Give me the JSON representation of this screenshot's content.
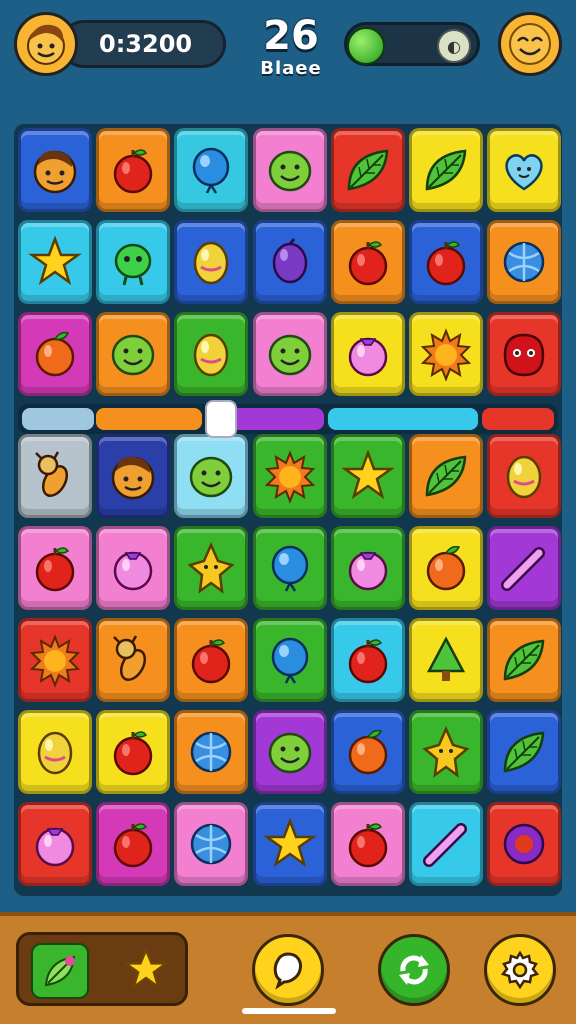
{
  "hud": {
    "score": "0:3200",
    "moves": "26",
    "moves_label": "Blaee",
    "colors": {
      "pill": "#233d50",
      "gem": "#3ec02c"
    }
  },
  "board": {
    "rows": [
      [
        {
          "c": "#2b62d8",
          "i": "face"
        },
        {
          "c": "#f5901f",
          "i": "apple"
        },
        {
          "c": "#35c8e0",
          "i": "balloon"
        },
        {
          "c": "#f27fd0",
          "i": "smile"
        },
        {
          "c": "#e6362a",
          "i": "leaf"
        },
        {
          "c": "#f6e01d",
          "i": "leaf"
        },
        {
          "c": "#f6e01d",
          "i": "heart"
        }
      ],
      [
        {
          "c": "#37c9ea",
          "i": "star"
        },
        {
          "c": "#37c9ea",
          "i": "alien"
        },
        {
          "c": "#2b62d8",
          "i": "egg"
        },
        {
          "c": "#2b62d8",
          "i": "plum"
        },
        {
          "c": "#f5901f",
          "i": "apple"
        },
        {
          "c": "#2b62d8",
          "i": "apple"
        },
        {
          "c": "#f5901f",
          "i": "ball"
        }
      ],
      [
        {
          "c": "#d43ab8",
          "i": "fruit"
        },
        {
          "c": "#f5901f",
          "i": "smile"
        },
        {
          "c": "#3ab62c",
          "i": "egg"
        },
        {
          "c": "#f27fd0",
          "i": "smile"
        },
        {
          "c": "#f6e01d",
          "i": "berry"
        },
        {
          "c": "#f6e01d",
          "i": "sun"
        },
        {
          "c": "#e6362a",
          "i": "blob"
        }
      ],
      [
        {
          "c": "#b7c3cc",
          "i": "bug"
        },
        {
          "c": "#2a3fa8",
          "i": "face"
        },
        {
          "c": "#90def3",
          "i": "smile"
        },
        {
          "c": "#3ab62c",
          "i": "sun"
        },
        {
          "c": "#3ab62c",
          "i": "star"
        },
        {
          "c": "#f5901f",
          "i": "leaf"
        },
        {
          "c": "#e6362a",
          "i": "egg"
        }
      ],
      [
        {
          "c": "#f27fd0",
          "i": "apple"
        },
        {
          "c": "#f27fd0",
          "i": "berry"
        },
        {
          "c": "#3ab62c",
          "i": "spark"
        },
        {
          "c": "#3ab62c",
          "i": "balloon"
        },
        {
          "c": "#3ab62c",
          "i": "berry"
        },
        {
          "c": "#f6e01d",
          "i": "fruit"
        },
        {
          "c": "#a238d6",
          "i": "wand"
        }
      ],
      [
        {
          "c": "#e6362a",
          "i": "sun"
        },
        {
          "c": "#f5901f",
          "i": "bug"
        },
        {
          "c": "#f5901f",
          "i": "apple"
        },
        {
          "c": "#3ab62c",
          "i": "balloon"
        },
        {
          "c": "#37c9ea",
          "i": "apple"
        },
        {
          "c": "#f6e01d",
          "i": "tree"
        },
        {
          "c": "#f5901f",
          "i": "leaf"
        }
      ],
      [
        {
          "c": "#f6e01d",
          "i": "egg"
        },
        {
          "c": "#f6e01d",
          "i": "apple"
        },
        {
          "c": "#f5901f",
          "i": "ball"
        },
        {
          "c": "#a238d6",
          "i": "smile"
        },
        {
          "c": "#2b62d8",
          "i": "fruit"
        },
        {
          "c": "#3ab62c",
          "i": "spark"
        },
        {
          "c": "#2b62d8",
          "i": "leaf"
        }
      ],
      [
        {
          "c": "#e6362a",
          "i": "berry"
        },
        {
          "c": "#d43ab8",
          "i": "apple"
        },
        {
          "c": "#f27fd0",
          "i": "ball"
        },
        {
          "c": "#2b62d8",
          "i": "star"
        },
        {
          "c": "#f27fd0",
          "i": "apple"
        },
        {
          "c": "#37c9ea",
          "i": "wand"
        },
        {
          "c": "#e6362a",
          "i": "ring"
        }
      ]
    ]
  },
  "slider": {
    "segments": [
      "#9fc7e0",
      "#f5901f",
      "#a238d6",
      "#37c9ea",
      "#e6362a"
    ],
    "knob_position": 0.35
  },
  "bottom": {
    "boosters": [
      "leaf-booster-icon",
      "star-booster-icon"
    ],
    "buttons": [
      "hint-button",
      "refresh-button",
      "settings-button"
    ]
  }
}
